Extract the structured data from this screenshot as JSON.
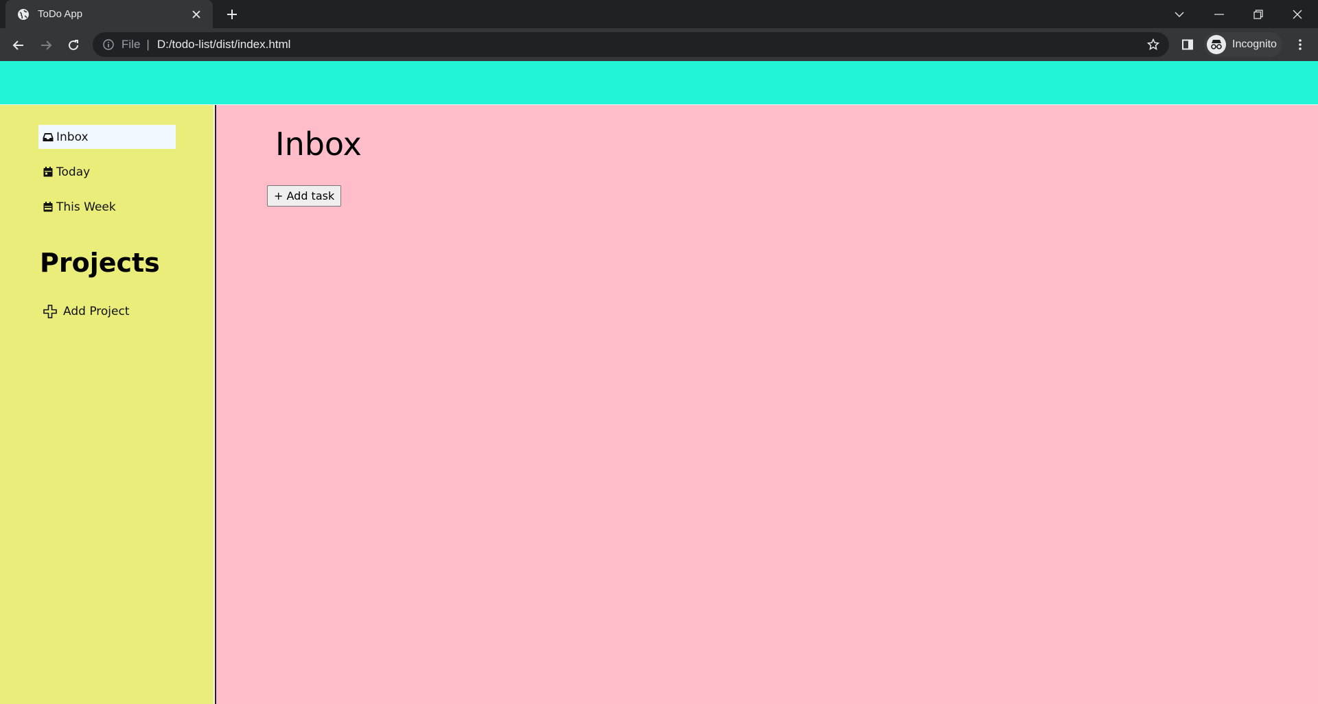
{
  "browser": {
    "tab_title": "ToDo App",
    "address_scheme": "File",
    "address_url": "D:/todo-list/dist/index.html",
    "profile_label": "Incognito"
  },
  "sidebar": {
    "items": [
      {
        "label": "Inbox",
        "icon": "inbox-icon"
      },
      {
        "label": "Today",
        "icon": "calendar-day-icon"
      },
      {
        "label": "This Week",
        "icon": "calendar-week-icon"
      }
    ],
    "projects_heading": "Projects",
    "add_project_label": "Add Project"
  },
  "main": {
    "title": "Inbox",
    "add_task_label": "+ Add task"
  },
  "colors": {
    "header": "#22f5d6",
    "sidebar": "#eaed7a",
    "main": "#ffbdca",
    "active_item": "#f2f8ff"
  }
}
